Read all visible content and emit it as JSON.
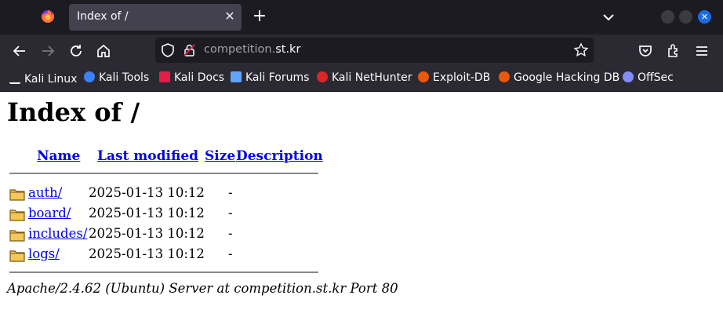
{
  "browser": {
    "tab": {
      "title": "Index of /"
    },
    "url": {
      "prefix": "competition.",
      "host": "st.kr"
    },
    "bookmarks": [
      {
        "label": "Kali Linux",
        "icon": "kali-dragon-icon",
        "color": "#ffffff"
      },
      {
        "label": "Kali Tools",
        "icon": "kali-tools-icon",
        "color": "#3b82f6"
      },
      {
        "label": "Kali Docs",
        "icon": "kali-docs-icon",
        "color": "#e11d48"
      },
      {
        "label": "Kali Forums",
        "icon": "kali-forums-icon",
        "color": "#60a5fa"
      },
      {
        "label": "Kali NetHunter",
        "icon": "nethunter-icon",
        "color": "#dc2626"
      },
      {
        "label": "Exploit-DB",
        "icon": "exploit-db-icon",
        "color": "#ea580c"
      },
      {
        "label": "Google Hacking DB",
        "icon": "ghdb-icon",
        "color": "#ea580c"
      },
      {
        "label": "OffSec",
        "icon": "offsec-icon",
        "color": "#818cf8"
      }
    ]
  },
  "page": {
    "title": "Index of /",
    "columns": {
      "name": "Name",
      "modified": "Last modified",
      "size": "Size",
      "description": "Description"
    },
    "entries": [
      {
        "name": "auth/",
        "modified": "2025-01-13 10:12",
        "size": "-"
      },
      {
        "name": "board/",
        "modified": "2025-01-13 10:12",
        "size": "-"
      },
      {
        "name": "includes/",
        "modified": "2025-01-13 10:12",
        "size": "-"
      },
      {
        "name": "logs/",
        "modified": "2025-01-13 10:12",
        "size": "-"
      }
    ],
    "footer": "Apache/2.4.62 (Ubuntu) Server at competition.st.kr Port 80"
  }
}
